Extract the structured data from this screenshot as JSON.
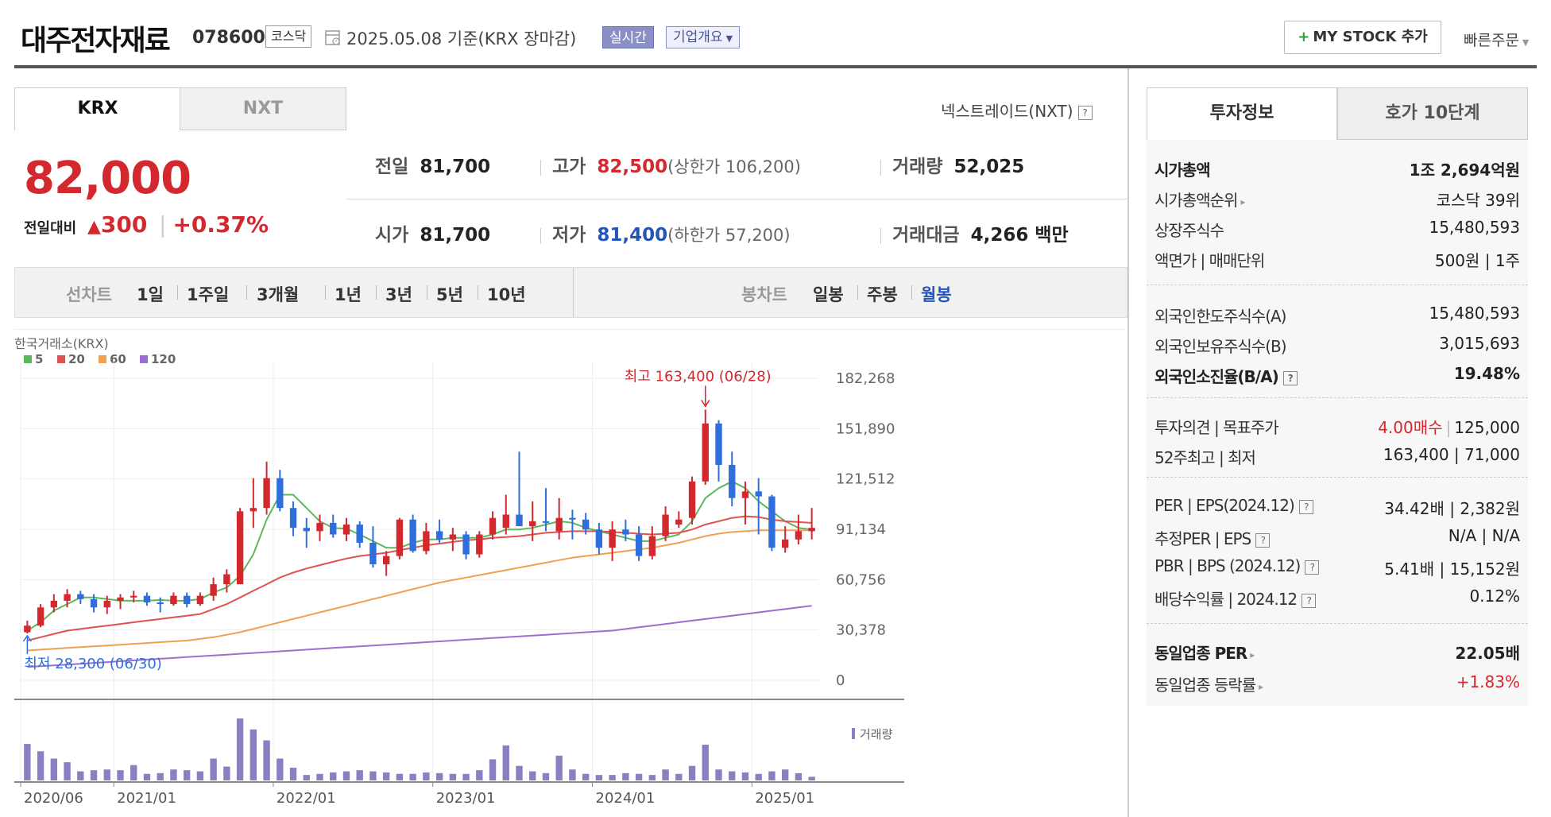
{
  "header": {
    "name": "대주전자재료",
    "code": "078600",
    "market": "코스닥",
    "date": "2025.05.08  기준(KRX 장마감)",
    "realtime": "실시간",
    "corp_info": "기업개요",
    "mystock": "MY STOCK 추가",
    "mystock_plus": "+",
    "quick_order": "빠른주문"
  },
  "tabs": {
    "krx": "KRX",
    "nxt": "NXT",
    "nxt_link": "넥스트레이드(NXT)",
    "help": "?"
  },
  "quote": {
    "price": "82,000",
    "change_label": "전일대비",
    "change_arrow": "▲",
    "change_amount": "300",
    "change_sep": "|",
    "change_pct": "+0.37%"
  },
  "stats": {
    "prev_label": "전일",
    "prev": "81,700",
    "high_label": "고가",
    "high": "82,500",
    "upper_limit": "(상한가 106,200)",
    "volume_label": "거래량",
    "volume": "52,025",
    "open_label": "시가",
    "open": "81,700",
    "low_label": "저가",
    "low": "81,400",
    "lower_limit": "(하한가 57,200)",
    "value_label": "거래대금",
    "value": "4,266 백만"
  },
  "period_bar": {
    "line_chart": "선차트",
    "periods": [
      "1일",
      "1주일",
      "3개월",
      "1년",
      "3년",
      "5년",
      "10년"
    ],
    "candle_chart": "봉차트",
    "candles": [
      "일봉",
      "주봉",
      "월봉"
    ],
    "selected_candle": "월봉"
  },
  "chart_data": {
    "type": "candlestick",
    "source_label": "한국거래소(KRX)",
    "legend": [
      {
        "name": "5",
        "color": "#5cb85c"
      },
      {
        "name": "20",
        "color": "#e0524f"
      },
      {
        "name": "60",
        "color": "#f0a050"
      },
      {
        "name": "120",
        "color": "#9b6fd0"
      }
    ],
    "yticks": [
      "182,268",
      "151,890",
      "121,512",
      "91,134",
      "60,756",
      "30,378",
      "0"
    ],
    "ylim": [
      0,
      182268
    ],
    "xticks": [
      {
        "label": "2020/06",
        "index": 0
      },
      {
        "label": "2021/01",
        "index": 7
      },
      {
        "label": "2022/01",
        "index": 19
      },
      {
        "label": "2023/01",
        "index": 31
      },
      {
        "label": "2024/01",
        "index": 43
      },
      {
        "label": "2025/01",
        "index": 55
      }
    ],
    "high_annot": "최고 163,400 (06/28)",
    "low_annot": "최저 28,300 (06/30)",
    "volume_label": "거래량",
    "up_color": "#d2282e",
    "down_color": "#2f6fdb",
    "ohlc": [
      [
        29000,
        36000,
        28300,
        33000
      ],
      [
        33000,
        46000,
        32000,
        44000
      ],
      [
        44000,
        52000,
        41000,
        48000
      ],
      [
        48000,
        55000,
        44000,
        52000
      ],
      [
        52000,
        54000,
        46000,
        49000
      ],
      [
        49000,
        52000,
        41000,
        44000
      ],
      [
        44000,
        51000,
        40000,
        48000
      ],
      [
        48000,
        52000,
        43000,
        50000
      ],
      [
        50000,
        54000,
        47000,
        51000
      ],
      [
        51000,
        53000,
        45000,
        47000
      ],
      [
        47000,
        50000,
        41000,
        46000
      ],
      [
        46000,
        53000,
        45000,
        51000
      ],
      [
        51000,
        53000,
        44000,
        46000
      ],
      [
        46000,
        53000,
        45000,
        51000
      ],
      [
        51000,
        62000,
        48000,
        58000
      ],
      [
        58000,
        67000,
        53000,
        64000
      ],
      [
        58000,
        104000,
        58000,
        102000
      ],
      [
        102000,
        122000,
        92000,
        104000
      ],
      [
        104000,
        132000,
        100000,
        122000
      ],
      [
        122000,
        127000,
        102000,
        104000
      ],
      [
        104000,
        108000,
        87000,
        92000
      ],
      [
        92000,
        98000,
        80000,
        90000
      ],
      [
        90000,
        100000,
        84000,
        95000
      ],
      [
        95000,
        100000,
        86000,
        88000
      ],
      [
        88000,
        98000,
        84000,
        94000
      ],
      [
        94000,
        96000,
        80000,
        83000
      ],
      [
        83000,
        93000,
        68000,
        70000
      ],
      [
        70000,
        78000,
        63000,
        75000
      ],
      [
        75000,
        98000,
        73000,
        97000
      ],
      [
        97000,
        100000,
        77000,
        78000
      ],
      [
        78000,
        95000,
        76000,
        90000
      ],
      [
        90000,
        97000,
        83000,
        85000
      ],
      [
        85000,
        92000,
        78000,
        88000
      ],
      [
        88000,
        90000,
        73000,
        76000
      ],
      [
        76000,
        90000,
        74000,
        88000
      ],
      [
        88000,
        102000,
        85000,
        98000
      ],
      [
        92000,
        112000,
        88000,
        100000
      ],
      [
        100000,
        138000,
        95000,
        93000
      ],
      [
        93000,
        108000,
        84000,
        96000
      ],
      [
        96000,
        116000,
        90000,
        95000
      ],
      [
        90000,
        110000,
        85000,
        98000
      ],
      [
        98000,
        103000,
        85000,
        97000
      ],
      [
        97000,
        101000,
        88000,
        91000
      ],
      [
        91000,
        95000,
        76000,
        80000
      ],
      [
        80000,
        96000,
        72000,
        91000
      ],
      [
        91000,
        97000,
        84000,
        88000
      ],
      [
        88000,
        93000,
        72000,
        75000
      ],
      [
        75000,
        93000,
        73000,
        87000
      ],
      [
        87000,
        105000,
        84000,
        100000
      ],
      [
        94000,
        102000,
        92000,
        97000
      ],
      [
        98000,
        123000,
        94000,
        120000
      ],
      [
        120000,
        163400,
        118000,
        155000
      ],
      [
        155000,
        157000,
        120000,
        130000
      ],
      [
        130000,
        138000,
        105000,
        110000
      ],
      [
        110000,
        120000,
        94000,
        114000
      ],
      [
        114000,
        122000,
        88000,
        111000
      ],
      [
        111000,
        112000,
        78000,
        80000
      ],
      [
        80000,
        93000,
        77000,
        85000
      ],
      [
        85000,
        100000,
        82000,
        90000
      ],
      [
        90000,
        104000,
        85000,
        92000
      ]
    ],
    "volume": [
      100,
      80,
      60,
      50,
      25,
      28,
      30,
      28,
      42,
      18,
      20,
      30,
      28,
      25,
      60,
      38,
      170,
      140,
      110,
      60,
      35,
      15,
      18,
      22,
      25,
      28,
      25,
      22,
      18,
      18,
      22,
      20,
      18,
      18,
      28,
      58,
      96,
      40,
      25,
      20,
      68,
      30,
      18,
      15,
      15,
      20,
      18,
      15,
      30,
      18,
      40,
      98,
      30,
      25,
      22,
      18,
      25,
      30,
      20,
      10
    ],
    "ma": {
      "5": [
        30000,
        35000,
        42000,
        46000,
        50000,
        50000,
        49000,
        48000,
        48000,
        48000,
        48500,
        48000,
        48000,
        49000,
        53000,
        56000,
        63000,
        76000,
        97000,
        112000,
        112000,
        104000,
        96000,
        92000,
        91500,
        88000,
        84000,
        80000,
        80000,
        83000,
        85000,
        85000,
        86000,
        86000,
        86000,
        88000,
        91000,
        91000,
        92000,
        94000,
        96000,
        95000,
        92000,
        90000,
        88000,
        86000,
        84000,
        84000,
        86000,
        88000,
        96000,
        110000,
        116000,
        120000,
        116000,
        108000,
        102000,
        96000,
        92000,
        91000
      ],
      "20": [
        24000,
        26000,
        28000,
        30000,
        31000,
        32000,
        33000,
        34000,
        35000,
        36000,
        37000,
        38000,
        39000,
        40000,
        43000,
        46000,
        50000,
        54000,
        58000,
        62000,
        65000,
        67500,
        69500,
        71500,
        73500,
        75000,
        76000,
        77000,
        78500,
        80000,
        81500,
        82500,
        83500,
        84500,
        85000,
        86000,
        86500,
        87000,
        88000,
        89000,
        89500,
        90000,
        90000,
        90000,
        89500,
        89000,
        88500,
        88000,
        88500,
        89000,
        91000,
        94000,
        96000,
        98000,
        99000,
        98500,
        97000,
        96000,
        95500,
        95000
      ],
      "60": [
        18000,
        18500,
        19000,
        19500,
        20000,
        20500,
        21000,
        21500,
        22000,
        22500,
        23000,
        23500,
        24000,
        25000,
        26000,
        27500,
        29000,
        31000,
        33000,
        35000,
        37000,
        39000,
        41000,
        43000,
        45000,
        47000,
        49000,
        51000,
        53000,
        55000,
        57000,
        59000,
        60500,
        62000,
        63500,
        65000,
        66500,
        68000,
        69500,
        71000,
        72500,
        74000,
        75000,
        76000,
        77000,
        78000,
        79000,
        80000,
        81500,
        83000,
        85000,
        87000,
        88500,
        89500,
        90000,
        90500,
        90500,
        90500,
        90500,
        90500
      ],
      "120": [
        8000,
        8500,
        9000,
        9500,
        10000,
        10500,
        11000,
        11500,
        12000,
        12500,
        13000,
        13500,
        14000,
        14500,
        15000,
        15500,
        16000,
        16500,
        17000,
        17500,
        18000,
        18500,
        19000,
        19500,
        20000,
        20500,
        21000,
        21500,
        22000,
        22500,
        23000,
        23500,
        24000,
        24500,
        25000,
        25500,
        26000,
        26500,
        27000,
        27500,
        28000,
        28500,
        29000,
        29500,
        30000,
        31000,
        32000,
        33000,
        34000,
        35000,
        36000,
        37000,
        38000,
        39000,
        40000,
        41000,
        42000,
        43000,
        44000,
        45000
      ]
    }
  },
  "invest": {
    "tab_invest": "투자정보",
    "tab_hoga": "호가 10단계",
    "rows": [
      {
        "k": "시가총액",
        "v": "1조 2,694억원"
      },
      {
        "k": "시가총액순위",
        "v": "코스닥 39위"
      },
      {
        "k": "상장주식수",
        "v": "15,480,593"
      },
      {
        "k": "액면가 | 매매단위",
        "v": "500원 | 1주"
      },
      {
        "k": "외국인한도주식수(A)",
        "v": "15,480,593"
      },
      {
        "k": "외국인보유주식수(B)",
        "v": "3,015,693"
      },
      {
        "k": "외국인소진율(B/A)",
        "v": "19.48%"
      },
      {
        "k": "투자의견 | 목표주가",
        "v1": "4.00매수",
        "v2": "125,000"
      },
      {
        "k": "52주최고 | 최저",
        "v": "163,400 | 71,000"
      },
      {
        "k": "PER | EPS(2024.12)",
        "v": "34.42배 | 2,382원"
      },
      {
        "k": "추정PER | EPS",
        "v": "N/A | N/A"
      },
      {
        "k": "PBR | BPS (2024.12)",
        "v": "5.41배 | 15,152원"
      },
      {
        "k": "배당수익률 | 2024.12",
        "v": "0.12%"
      },
      {
        "k": "동일업종 PER",
        "v": "22.05배"
      },
      {
        "k": "동일업종 등락률",
        "v": "+1.83%"
      }
    ]
  }
}
